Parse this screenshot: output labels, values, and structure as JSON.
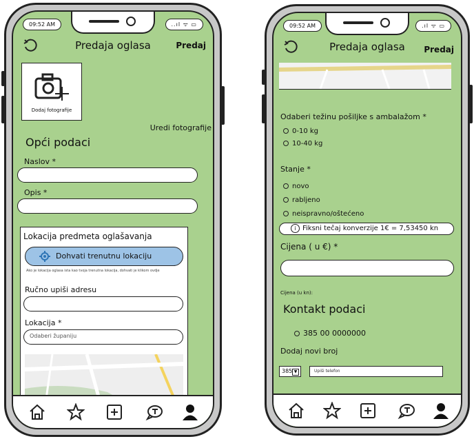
{
  "left_phone": {
    "status": {
      "time": "09:52 AM",
      "icons": "..ıl ᯤ ▭"
    },
    "appbar": {
      "title": "Predaja oglasa",
      "submit": "Predaj"
    },
    "photo_box": {
      "caption": "Dodaj fotografije"
    },
    "edit_photos": "Uredi fotografije",
    "general": {
      "title": "Opći podaci",
      "title_label": "Naslov *",
      "description_label": "Opis *"
    },
    "location": {
      "title": "Lokacija predmeta oglašavanja",
      "fetch_button": "Dohvati trenutnu lokaciju",
      "hint": "Ako je lokacija oglasa ista kao tvoja trenutna lokacija, dohvati je klikom ovdje",
      "manual_label": "Ručno upiši adresu",
      "county_label": "Lokacija *",
      "county_placeholder": "Odaberi županiju"
    }
  },
  "right_phone": {
    "status": {
      "time": "09:52 AM",
      "icons": ".ıl ᯤ ▭"
    },
    "appbar": {
      "title": "Predaja oglasa",
      "submit": "Predaj"
    },
    "weight": {
      "label": "Odaberi težinu pošiljke s ambalažom *",
      "options": [
        "0-10 kg",
        "10-40 kg"
      ]
    },
    "condition": {
      "label": "Stanje *",
      "options": [
        "novo",
        "rabljeno",
        "neispravno/oštećeno"
      ]
    },
    "conversion_info": "Fiksni tečaj konverzije 1€ = 7,53450 kn",
    "price_label": "Cijena ( u €) *",
    "price_kn_label": "Cijena (u kn):",
    "contact": {
      "title": "Kontakt podaci",
      "number": "385 00 0000000",
      "add_label": "Dodaj novi broj",
      "country_code": "385",
      "phone_placeholder": "Upiši telefon"
    }
  },
  "colors": {
    "screen_bg": "#a9d18e",
    "button_blue": "#9dc3e6",
    "frame": "#222222"
  }
}
